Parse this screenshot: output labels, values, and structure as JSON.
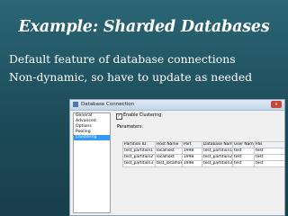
{
  "slide": {
    "title": "Example: Sharded Databases",
    "bullets": [
      "Default feature of database connections",
      "Non-dynamic, so have to update as needed"
    ]
  },
  "dialog": {
    "title": "Database Connection",
    "close_label": "x",
    "nav_items": [
      "General",
      "Advanced",
      "Options",
      "Pooling",
      "Clustering"
    ],
    "selected_nav": "Clustering",
    "enable_clustering": {
      "label": "Enable Clustering",
      "checked_mark": "✓"
    },
    "parameters_label": "Parameters:",
    "table": {
      "headers": [
        "Partition ID",
        "Host Name",
        "Port",
        "Database Name",
        "User Name",
        "Pas"
      ],
      "rows": [
        [
          "test_partition1",
          "localhost",
          "1998",
          "test_partition1",
          "test",
          "test"
        ],
        [
          "test_partition2",
          "localhost",
          "1998",
          "test_partition2",
          "test",
          "test"
        ],
        [
          "test_partition3",
          "test_localhost",
          "1998",
          "test_partition3",
          "test",
          "test"
        ]
      ]
    }
  },
  "colors": {
    "slide_background": "#1f4f5c",
    "selected_item": "#3399ff"
  }
}
